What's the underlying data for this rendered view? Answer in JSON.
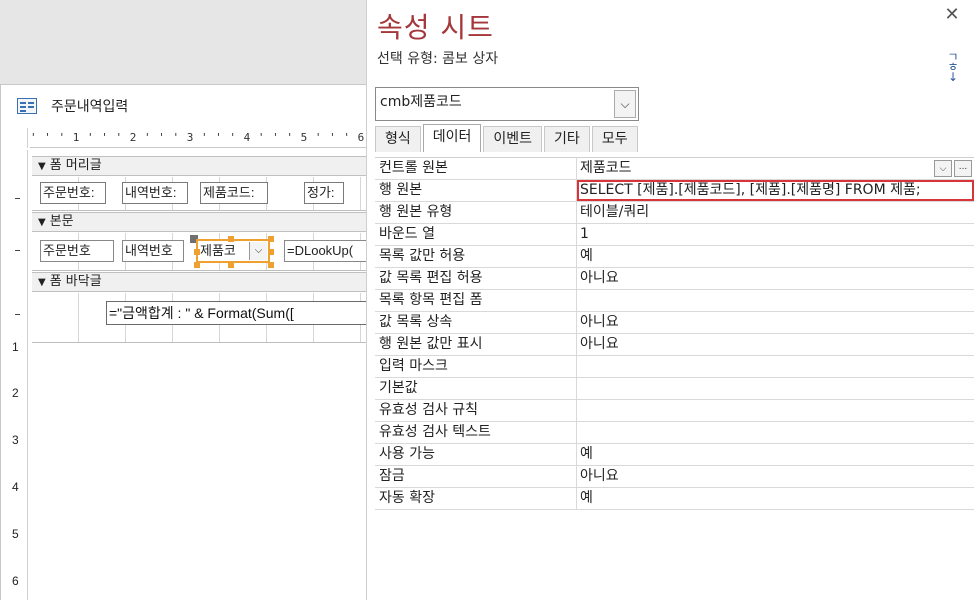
{
  "form_document": {
    "tab_title": "주문내역입력",
    "horizontal_ruler": "' ' ' 1 ' ' ' 2 ' ' ' 3 ' ' ' 4 ' ' ' 5 ' ' ' 6 ' ' ' ",
    "vertical_ruler_marks": [
      "1",
      "2",
      "3",
      "4",
      "5",
      "6"
    ],
    "sections": {
      "header": "폼 머리글",
      "detail": "본문",
      "footer": "폼 바닥글"
    },
    "header_labels": {
      "order_no": "주문번호:",
      "detail_no": "내역번호:",
      "product_code": "제품코드:",
      "price": "정가:"
    },
    "detail_controls": {
      "order_no": "주문번호",
      "detail_no": "내역번호",
      "product_combo": "제품코",
      "dlookup": "=DLookUp("
    },
    "footer_expression": "=\"금액합계 : \" & Format(Sum(["
  },
  "property_sheet": {
    "title": "속성 시트",
    "selection_type": "선택 유형: 콤보 상자",
    "object_name": "cmb제품코드",
    "tabs": [
      "형식",
      "데이터",
      "이벤트",
      "기타",
      "모두"
    ],
    "active_tab": "데이터",
    "properties": [
      {
        "name": "컨트롤 원본",
        "value": "제품코드"
      },
      {
        "name": "행 원본",
        "value": "SELECT [제품].[제품코드], [제품].[제품명] FROM 제품;"
      },
      {
        "name": "행 원본 유형",
        "value": "테이블/쿼리"
      },
      {
        "name": "바운드 열",
        "value": "1"
      },
      {
        "name": "목록 값만 허용",
        "value": "예"
      },
      {
        "name": "값 목록 편집 허용",
        "value": "아니요"
      },
      {
        "name": "목록 항목 편집 폼",
        "value": ""
      },
      {
        "name": "값 목록 상속",
        "value": "아니요"
      },
      {
        "name": "행 원본 값만 표시",
        "value": "아니요"
      },
      {
        "name": "입력 마스크",
        "value": ""
      },
      {
        "name": "기본값",
        "value": ""
      },
      {
        "name": "유효성 검사 규칙",
        "value": ""
      },
      {
        "name": "유효성 검사 텍스트",
        "value": ""
      },
      {
        "name": "사용 가능",
        "value": "예"
      },
      {
        "name": "잠금",
        "value": "아니요"
      },
      {
        "name": "자동 확장",
        "value": "예"
      }
    ],
    "highlight_color": "#d9343a",
    "title_color": "#a4373a",
    "selection_color": "#f0a030"
  }
}
